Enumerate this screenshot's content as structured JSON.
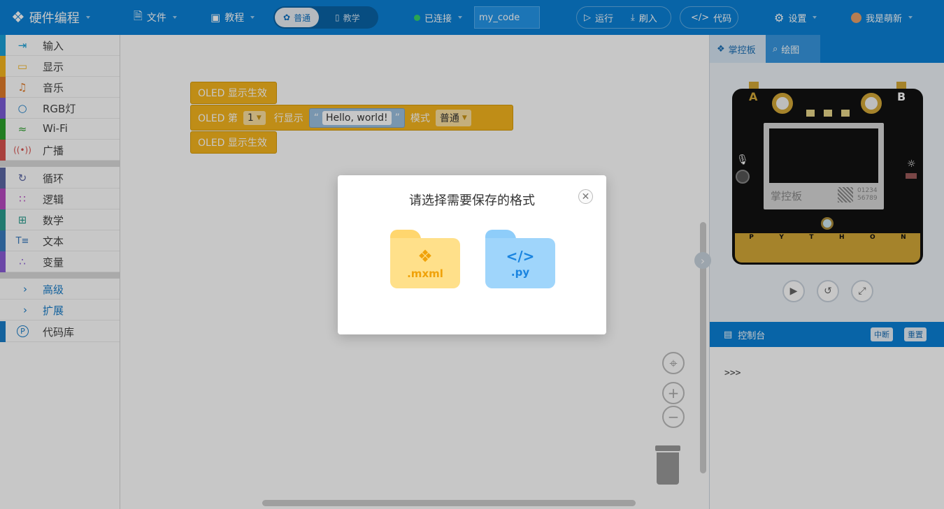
{
  "header": {
    "app_title": "硬件编程",
    "file_label": "文件",
    "tutorial_label": "教程",
    "mode_normal": "普通",
    "mode_teach": "教学",
    "status": "已连接",
    "project_name": "my_code",
    "run_label": "运行",
    "flash_label": "刷入",
    "code_label": "代码",
    "settings_label": "设置",
    "user_label": "我是萌新"
  },
  "sidebar": {
    "items": [
      {
        "label": "输入",
        "color": "#1aa0d8",
        "icon": "input-icon"
      },
      {
        "label": "显示",
        "color": "#f5b51e",
        "icon": "display-icon"
      },
      {
        "label": "音乐",
        "color": "#e07c2a",
        "icon": "music-icon"
      },
      {
        "label": "RGB灯",
        "color": "#7a5cd6",
        "icon": "bulb-icon"
      },
      {
        "label": "Wi-Fi",
        "color": "#2ca02c",
        "icon": "wifi-icon"
      },
      {
        "label": "广播",
        "color": "#d9534f",
        "icon": "broadcast-icon"
      },
      {
        "label": "循环",
        "color": "#5b67a5",
        "icon": "loop-icon"
      },
      {
        "label": "逻辑",
        "color": "#b84ac0",
        "icon": "logic-icon"
      },
      {
        "label": "数学",
        "color": "#2a9d8f",
        "icon": "math-icon"
      },
      {
        "label": "文本",
        "color": "#3a7bbf",
        "icon": "text-icon"
      },
      {
        "label": "变量",
        "color": "#8a5cd6",
        "icon": "variable-icon"
      }
    ],
    "advanced": "高级",
    "extension": "扩展",
    "codelib": "代码库"
  },
  "blocks": {
    "oled_show": "OLED 显示生效",
    "line_prefix": "OLED 第",
    "line_num": "1",
    "line_suffix": "行显示",
    "text_value": "Hello, world!",
    "mode_label": "模式",
    "mode_value": "普通"
  },
  "right_panel": {
    "tab_board": "掌控板",
    "tab_draw": "绘图",
    "board_pin_a": "A",
    "board_pin_b": "B",
    "board_logo": "掌控板",
    "board_num": "01234\n56789",
    "board_letters": [
      "P",
      "Y",
      "T",
      "H",
      "O",
      "N"
    ],
    "console_title": "控制台",
    "interrupt_label": "中断",
    "reset_label": "重置",
    "console_text": ">>>"
  },
  "dialog": {
    "title": "请选择需要保存的格式",
    "option_mxml": ".mxml",
    "option_py": ".py"
  },
  "colors": {
    "brand": "#0b81d6",
    "block_yellow": "#f5b51e",
    "folder_yellow": "#ffe08a",
    "folder_blue": "#9fd5fb"
  }
}
